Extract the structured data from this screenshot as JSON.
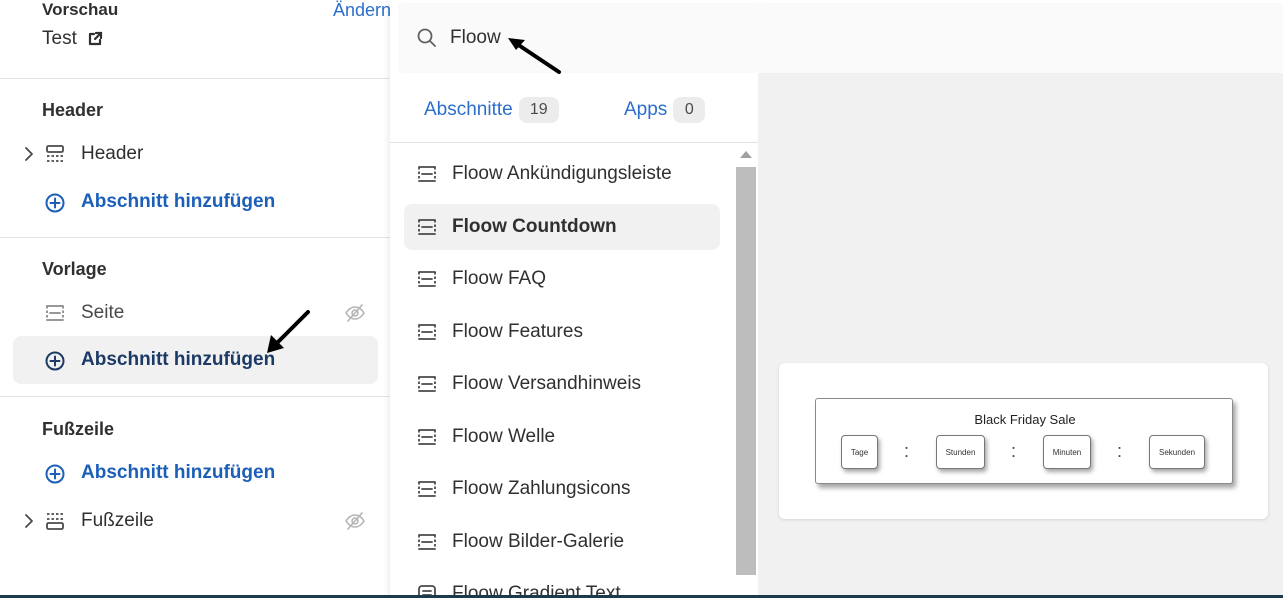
{
  "sidebar": {
    "preview_title": "Vorschau",
    "change_link": "Ändern",
    "theme_name": "Test",
    "header_section": {
      "title": "Header",
      "item_label": "Header",
      "add_label": "Abschnitt hinzufügen"
    },
    "template_section": {
      "title": "Vorlage",
      "item_label": "Seite",
      "add_label": "Abschnitt hinzufügen"
    },
    "footer_section": {
      "title": "Fußzeile",
      "add_label": "Abschnitt hinzufügen",
      "item_label": "Fußzeile"
    }
  },
  "picker": {
    "search_value": "Floow",
    "tabs": [
      {
        "label": "Abschnitte",
        "count": "19"
      },
      {
        "label": "Apps",
        "count": "0"
      }
    ],
    "items": [
      {
        "label": "Floow Ankündigungsleiste",
        "selected": false
      },
      {
        "label": "Floow Countdown",
        "selected": true
      },
      {
        "label": "Floow FAQ",
        "selected": false
      },
      {
        "label": "Floow Features",
        "selected": false
      },
      {
        "label": "Floow Versandhinweis",
        "selected": false
      },
      {
        "label": "Floow Welle",
        "selected": false
      },
      {
        "label": "Floow Zahlungsicons",
        "selected": false
      },
      {
        "label": "Floow Bilder-Galerie",
        "selected": false
      },
      {
        "label": "Floow Gradient Text",
        "selected": false
      }
    ]
  },
  "preview": {
    "title": "Black Friday Sale",
    "units": [
      "Tage",
      "Stunden",
      "Minuten",
      "Sekunden"
    ],
    "separator": ":"
  },
  "colors": {
    "accent": "#2c6ecb",
    "accent_dark": "#1c5fb8",
    "selected_bg": "#f1f1f1",
    "canvas_bg": "#f1f1f1"
  }
}
